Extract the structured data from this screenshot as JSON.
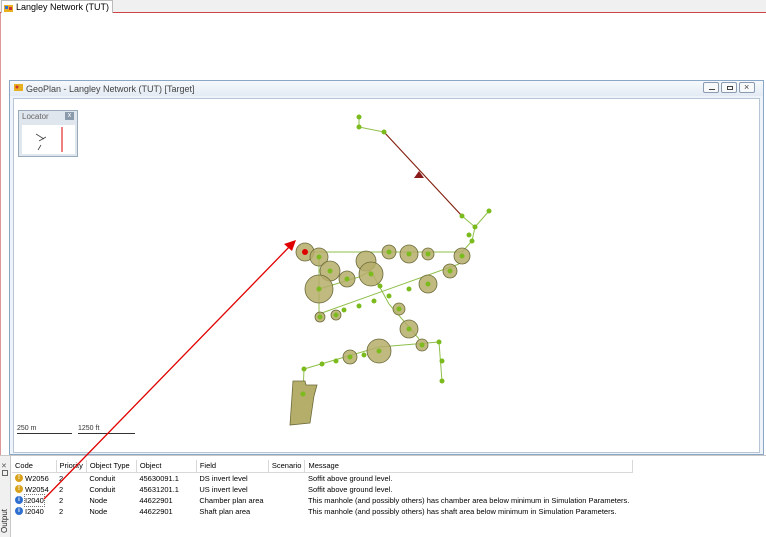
{
  "document_tab": {
    "label": "Langley Network (TUT)"
  },
  "geoplan": {
    "title": "GeoPlan - Langley Network (TUT) [Target]",
    "locator": {
      "title": "Locator",
      "close": "x"
    },
    "scalebars": [
      "250 m",
      "1250 ft"
    ]
  },
  "output": {
    "side_label": "Output",
    "columns": [
      "Code",
      "Priority",
      "Object Type",
      "Object",
      "Field",
      "Scenario",
      "Message"
    ],
    "rows": [
      {
        "icon": "warning-icon",
        "code": "W2056",
        "priority": "2",
        "object_type": "Conduit",
        "object": "45630091.1",
        "field": "DS invert level",
        "scenario": "",
        "message": "Soffit above ground level."
      },
      {
        "icon": "warning-icon",
        "code": "W2054",
        "priority": "2",
        "object_type": "Conduit",
        "object": "45631201.1",
        "field": "US invert level",
        "scenario": "",
        "message": "Soffit above ground level."
      },
      {
        "icon": "info-icon",
        "code": "I2040",
        "priority": "2",
        "object_type": "Node",
        "object": "44622901",
        "field": "Chamber plan area",
        "scenario": "",
        "message": "This manhole (and possibly others) has chamber area below minimum in Simulation Parameters."
      },
      {
        "icon": "info-icon",
        "code": "I2040",
        "priority": "2",
        "object_type": "Node",
        "object": "44622901",
        "field": "Shaft plan area",
        "scenario": "",
        "message": "This manhole (and possibly others) has shaft area below minimum in Simulation Parameters."
      }
    ]
  },
  "colors": {
    "node_fill": "#7cbb1e",
    "manhole_area": "#b5ad6a",
    "link_line": "#8fbf4a",
    "highlight": "#e00000",
    "tracked_line": "#8b1a1a"
  }
}
